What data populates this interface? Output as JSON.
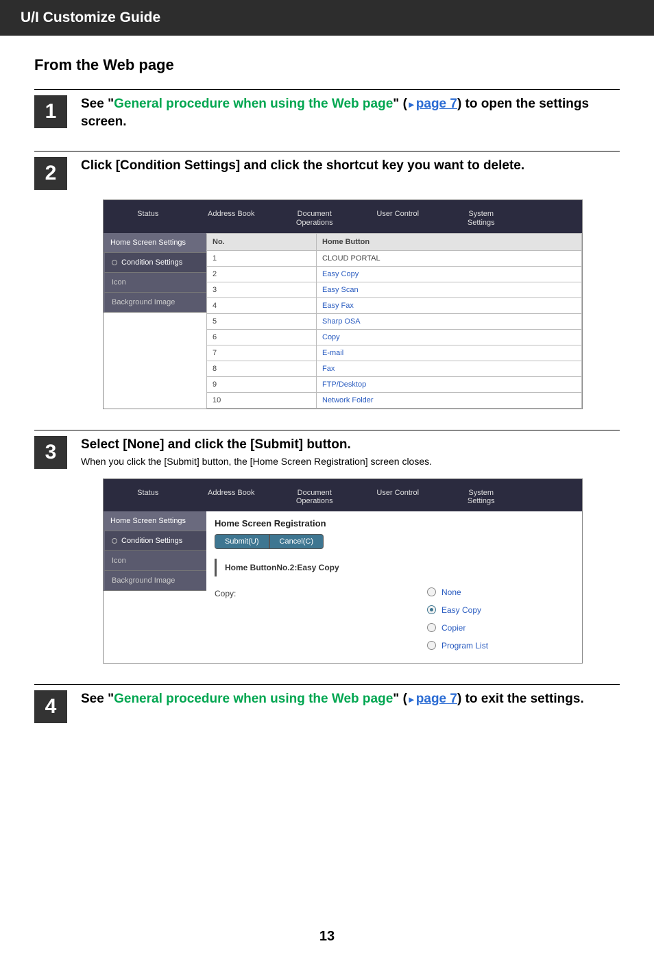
{
  "header": {
    "title": "U/I Customize Guide"
  },
  "section_title": "From the Web page",
  "steps": [
    {
      "num": "1",
      "head_prefix": "See \"",
      "head_link_green": "General procedure when using the Web page",
      "head_mid": "\" (",
      "head_tri": "►",
      "head_link_page": "page 7",
      "head_suffix": ") to open the settings screen."
    },
    {
      "num": "2",
      "head": "Click [Condition Settings] and click the shortcut key you want to delete."
    },
    {
      "num": "3",
      "head": "Select [None] and click the [Submit] button.",
      "sub": "When you click the [Submit] button, the [Home Screen Registration] screen closes."
    },
    {
      "num": "4",
      "head_prefix": "See \"",
      "head_link_green": "General procedure when using the Web page",
      "head_mid": "\" (",
      "head_tri": "►",
      "head_link_page": "page 7",
      "head_suffix": ") to exit the settings."
    }
  ],
  "tabs": [
    "Status",
    "Address Book",
    "Document\nOperations",
    "User Control",
    "System\nSettings"
  ],
  "sidebar": {
    "title": "Home Screen Settings",
    "items": [
      "Condition Settings",
      "Icon",
      "Background Image"
    ]
  },
  "table1": {
    "headers": [
      "No.",
      "Home Button"
    ],
    "rows": [
      [
        "1",
        "CLOUD PORTAL"
      ],
      [
        "2",
        "Easy Copy"
      ],
      [
        "3",
        "Easy Scan"
      ],
      [
        "4",
        "Easy Fax"
      ],
      [
        "5",
        "Sharp OSA"
      ],
      [
        "6",
        "Copy"
      ],
      [
        "7",
        "E-mail"
      ],
      [
        "8",
        "Fax"
      ],
      [
        "9",
        "FTP/Desktop"
      ],
      [
        "10",
        "Network Folder"
      ]
    ]
  },
  "reg": {
    "title": "Home Screen Registration",
    "submit": "Submit(U)",
    "cancel": "Cancel(C)",
    "group": "Home ButtonNo.2:Easy Copy",
    "copy_label": "Copy:",
    "radios": [
      "None",
      "Easy Copy",
      "Copier",
      "Program List"
    ],
    "selected": 1
  },
  "page_number": "13"
}
